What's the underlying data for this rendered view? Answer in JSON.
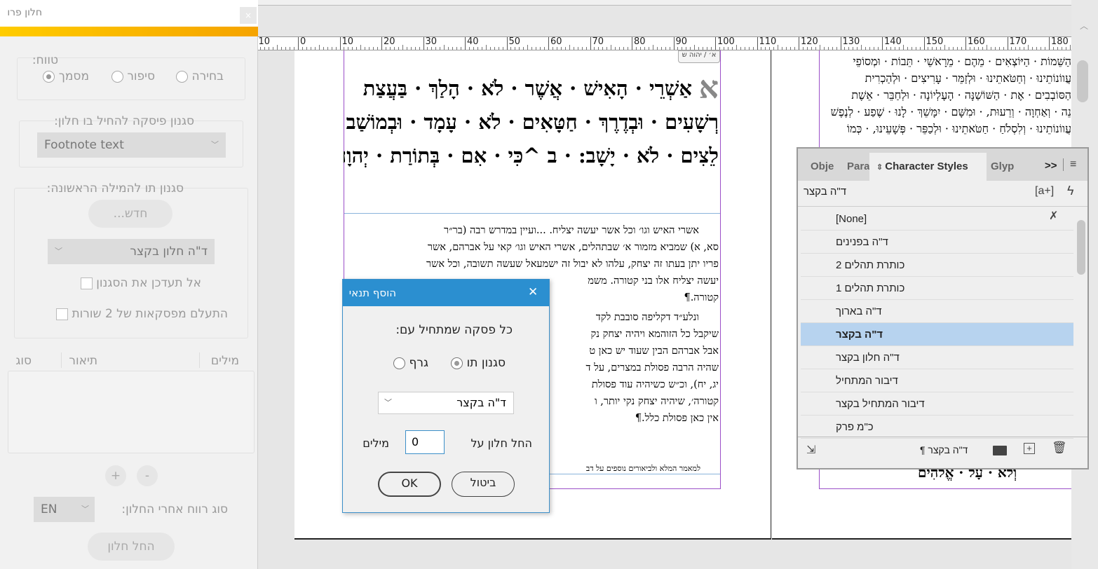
{
  "plugin_panel": {
    "title": "חלון פרו",
    "close": "×",
    "range": {
      "label": "טווח:",
      "options": [
        {
          "label": "מסמך",
          "selected": true
        },
        {
          "label": "סיפור",
          "selected": false
        },
        {
          "label": "בחירה",
          "selected": false
        }
      ]
    },
    "para_style": {
      "label": "סגנון פיסקה להחיל בו חלון:",
      "value": "Footnote text"
    },
    "first_word": {
      "label": "סגנון תו להמילה הראשונה:",
      "new_button": "חדש...",
      "value": "ד\"ה חלון בקצר",
      "checkbox1": "אל תעדכן את הסגנון",
      "checkbox2": "התעלם מפסקאות של 2 שורות"
    },
    "table": {
      "columns": [
        "מילים",
        "תיאור",
        "סוג"
      ]
    },
    "plus": "+",
    "minus": "-",
    "space_type": {
      "label": "סוג רווח אחרי החלון:",
      "value": "EN"
    },
    "apply_button": "החל חלון"
  },
  "ruler": {
    "labels": [
      "10",
      "0",
      "10",
      "20",
      "30",
      "40",
      "50",
      "60",
      "70",
      "80",
      "90",
      "100",
      "110",
      "120",
      "130",
      "140",
      "150",
      "160",
      "170",
      "180"
    ]
  },
  "document": {
    "header_tag": "א׳ / יהוה ש",
    "big_letter": "א",
    "verse_lines": [
      "אַשְׁרֵי · הָאִישׁ · אֲשֶׁר · לֹא · הָלַךְ · בַּעֲצַת",
      "רְשָׁעִים · וּבְדֶרֶךְ · חַטָּאִים · לֹא · עָמָד · וּבְמוֹשַׁב",
      "לֵצִים · לֹא · יָשָׁב: · ב ^כִּי · אִם · בְּתוֹרַת · יְהוָה · חֶפְצוֹ"
    ],
    "comment_lines": [
      "אשרי האיש וגו׳ וכל אשר יעשה יצליח. ...ועיין במדרש רבה (בר״ר",
      "סא, א) שמביא מזמור א׳ שבתהלים, אשרי האיש וגו׳ קאי על אברהם, אשר",
      "פריו יתן בעתו זה יצחק, עלהו לא יבול זה ישמעאל שעשה תשובה, וכל אשר",
      "יעשה יצליח אלו בני קטורה. משמ",
      "קטורה.¶",
      "ונלע״ד דקליפה סובבת לקד",
      "שיקבל כל הזוהמא ויהיה יצחק נק",
      "אבל אברהם הבין שעוד יש כאן ט",
      "שהיה הרבה פסולת במצרים, על ד",
      "יג, יח), וכ״ש כשיהיה עוד פסולת",
      "קטורה׳, שיהיה יצחק נקי יותר, ו",
      "אין כאן פסולת כלל.¶"
    ],
    "footer_line": "למאמר המלא ולביאורים נוספים על דב",
    "right_page_lines": [
      "הַשֵּׁמוֹת · הַיּוֹצְאִים · מֵהֶם · מֵרָאשֵׁי · תֵּבוֹת · וּמְסוֹפֵי",
      "עֲווֹנוֹתֵינוּ · וְחַטֹּאתֵינוּ · וּלְזַמֵּר · עָרִיצִים · וּלְהַכְרִית",
      "הַסּוֹבְבִים · אֶת · הַשּׁוֹשַׁנָּה · הָעֶלְיוֹנָה · וּלְחַבֵּר · אֵשֶׁת",
      "נֵה · וְאַחְוָה · וְרֵעוּת, · וּמִשָּׁם · יִמָּשֵׁךְ · לָנוּ · שֶׁפַע · לְנֶפֶשׁ",
      "עֲווֹנוֹתֵינוּ · וְלִסְלֹחַ · חַטֹּאתֵינוּ · וּלְכַפֵּר · פְּשָׁעֵינוּ, · כְּמוֹ"
    ],
    "right_page_bottom": "וְלֹא · עָל · אֱלֹהִים"
  },
  "dialog": {
    "title": "הוסף תנאי",
    "close": "✕",
    "prompt": "כל פסקה שמתחיל עם:",
    "options": [
      {
        "label": "סגנון תו",
        "selected": true
      },
      {
        "label": "גרף",
        "selected": false
      }
    ],
    "style_value": "ד\"ה בקצר",
    "apply_prefix": "החל חלון על",
    "words_value": "0",
    "apply_suffix": "מילים",
    "ok": "OK",
    "cancel": "ביטול"
  },
  "char_styles": {
    "tabs": [
      "Obje",
      "Para",
      "Character Styles",
      "Glyp"
    ],
    "more": ">>",
    "current": "ד\"ה בקצר",
    "items": [
      "[None]",
      "ד\"ה בפנינים",
      "כותרת תהלים 2",
      "כותרת תהלים 1",
      "ד\"ה בארוך",
      "ד\"ה בקצר",
      "ד\"ה חלון בקצר",
      "דיבור המתחיל",
      "דיבור המתחיל בקצר",
      "כ\"מ פרק"
    ],
    "selected_index": 5,
    "footer_style": "ד\"ה בקצר ¶",
    "create_icon_text": "[a+]",
    "accent": "#b7d3ef"
  }
}
